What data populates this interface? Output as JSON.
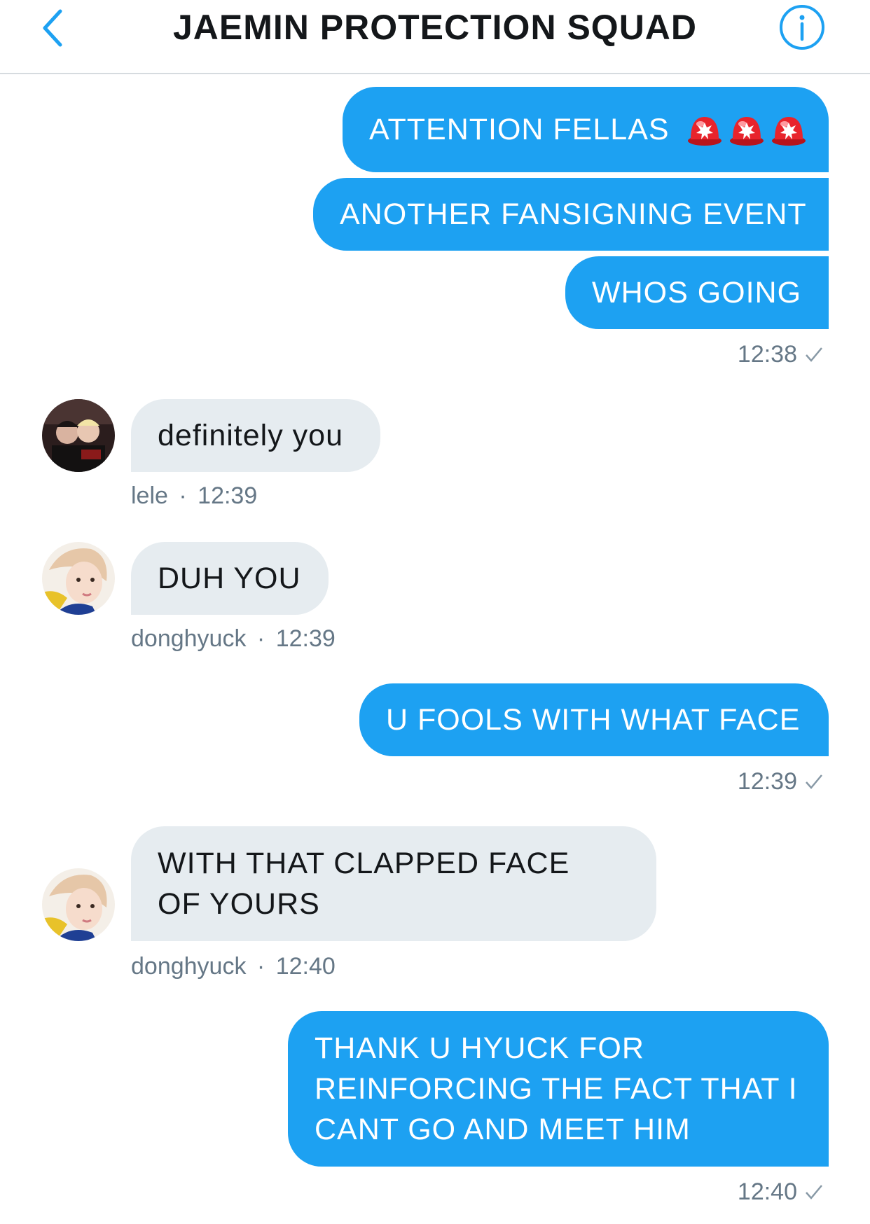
{
  "header": {
    "title": "JAEMIN PROTECTION SQUAD",
    "back_icon": "chevron-left-icon",
    "info_icon": "info-icon"
  },
  "colors": {
    "accent": "#1da1f2",
    "incoming_bubble": "#e6ecf0",
    "meta_text": "#657786"
  },
  "messages": [
    {
      "direction": "out",
      "text": "ATTENTION FELLAS",
      "emoji": "rotating-light-icon ×3"
    },
    {
      "direction": "out",
      "text": "ANOTHER FANSIGNING EVENT"
    },
    {
      "direction": "out",
      "text": "WHOS GOING",
      "time": "12:38",
      "status_icon": "check-icon"
    },
    {
      "direction": "in",
      "text": "definitely you",
      "sender": "lele",
      "time": "12:39"
    },
    {
      "direction": "in",
      "text": "DUH YOU",
      "sender": "donghyuck",
      "time": "12:39"
    },
    {
      "direction": "out",
      "text": "U FOOLS WITH WHAT FACE",
      "time": "12:39",
      "status_icon": "check-icon"
    },
    {
      "direction": "in",
      "text": "WITH THAT CLAPPED FACE OF YOURS",
      "sender": "donghyuck",
      "time": "12:40"
    },
    {
      "direction": "out",
      "text": "THANK U HYUCK FOR REINFORCING THE FACT THAT I CANT GO AND MEET HIM",
      "time": "12:40",
      "status_icon": "check-icon"
    }
  ],
  "meta_separator": "·"
}
